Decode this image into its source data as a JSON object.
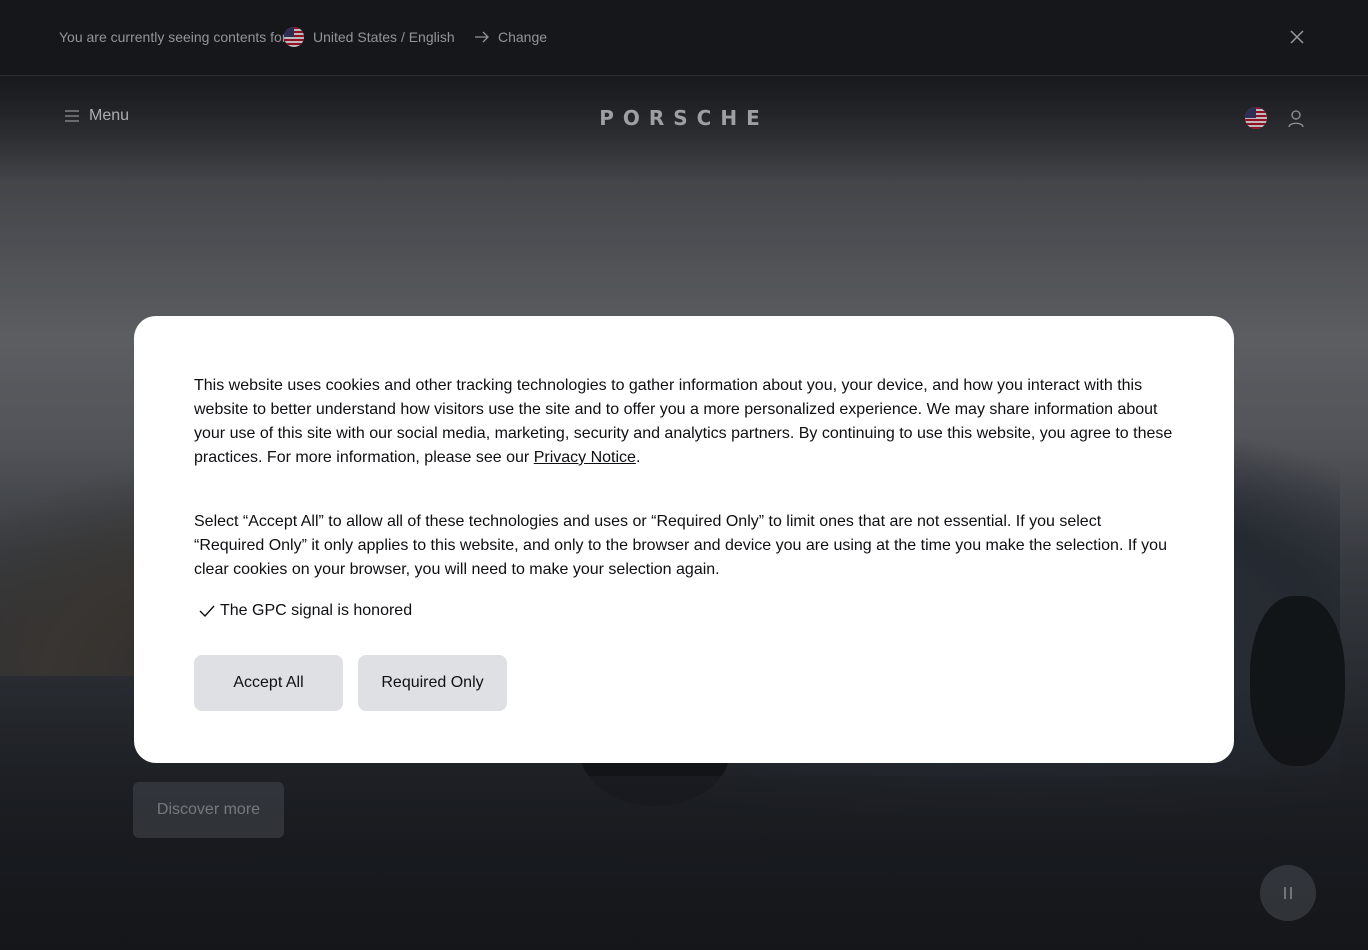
{
  "topbar": {
    "label": "You are currently seeing contents for:",
    "region": "United States / English",
    "change_label": "Change"
  },
  "header": {
    "menu_label": "Menu",
    "logo_text": "PORSCHE"
  },
  "hero": {
    "discover_label": "Discover more"
  },
  "cookie": {
    "p1_text": "This website uses cookies and other tracking technologies to gather information about you, your device, and how you interact with this website to better understand how visitors use the site and to offer you a more personalized experience. We may share information about your use of this site with our social media, marketing, security and analytics partners. By continuing to use this website, you agree to these practices. For more information, please see our ",
    "privacy_link": "Privacy Notice",
    "p1_end": ".",
    "p2_text": "Select “Accept All” to allow all of these technologies and uses or “Required Only” to limit ones that are not essential. If you select “Required Only” it only applies to this website, and only to the browser and device you are using at the time you make the selection. If you clear cookies on your browser, you will need to make your selection again.",
    "gpc_text": "The GPC signal is honored",
    "accept_label": "Accept All",
    "required_label": "Required Only"
  },
  "icons": {
    "flag": "us-flag-icon",
    "change": "arrow-right-icon",
    "close": "close-icon",
    "menu": "hamburger-icon",
    "user": "user-icon",
    "check": "checkmark-icon",
    "pause": "pause-icon"
  },
  "colors": {
    "topbar_bg": "#1a1c20",
    "modal_bg": "#ffffff",
    "button_bg": "#dfe0e3",
    "text_dark": "#0e0f12"
  }
}
